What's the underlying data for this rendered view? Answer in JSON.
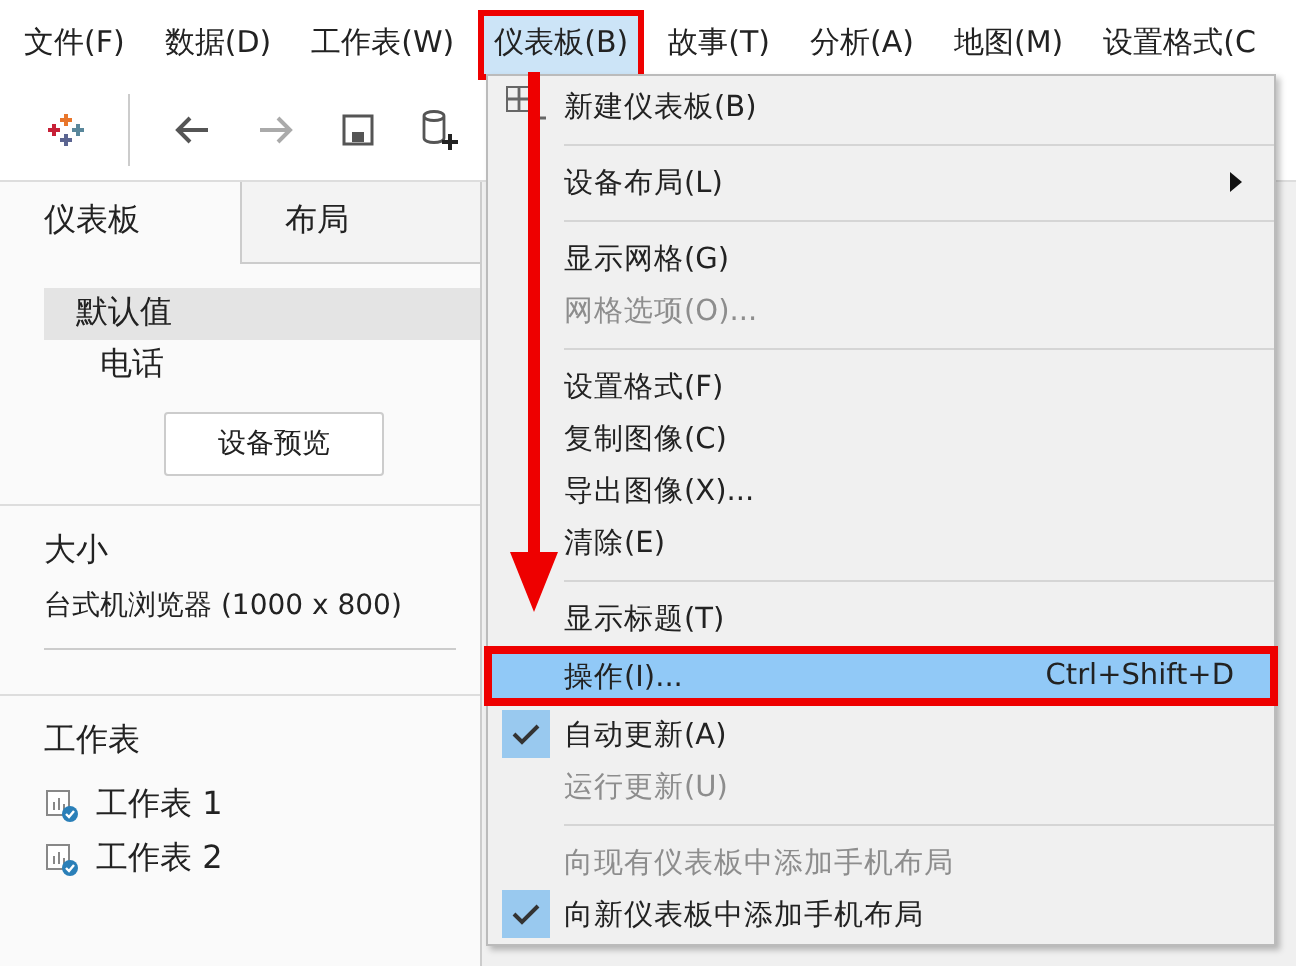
{
  "menubar": [
    {
      "label": "文件(F)",
      "selected": false
    },
    {
      "label": "数据(D)",
      "selected": false
    },
    {
      "label": "工作表(W)",
      "selected": false
    },
    {
      "label": "仪表板(B)",
      "selected": true
    },
    {
      "label": "故事(T)",
      "selected": false
    },
    {
      "label": "分析(A)",
      "selected": false
    },
    {
      "label": "地图(M)",
      "selected": false
    },
    {
      "label": "设置格式(C",
      "selected": false
    }
  ],
  "panel": {
    "tabs": [
      {
        "label": "仪表板",
        "selected": true
      },
      {
        "label": "布局",
        "selected": false
      }
    ],
    "devices": [
      {
        "label": "默认值",
        "selected": true
      },
      {
        "label": "电话",
        "selected": false
      }
    ],
    "preview_button": "设备预览",
    "size_heading": "大小",
    "size_value": "台式机浏览器 (1000 x 800)",
    "sheets_heading": "工作表",
    "sheets": [
      {
        "label": "工作表 1"
      },
      {
        "label": "工作表 2"
      }
    ]
  },
  "menu": [
    {
      "kind": "item",
      "label": "新建仪表板(B)",
      "icon": true,
      "disabled": false,
      "checked": false,
      "submenu": false,
      "selected": false
    },
    {
      "kind": "separator"
    },
    {
      "kind": "item",
      "label": "设备布局(L)",
      "disabled": false,
      "checked": false,
      "submenu": true,
      "selected": false
    },
    {
      "kind": "separator"
    },
    {
      "kind": "item",
      "label": "显示网格(G)",
      "disabled": false,
      "checked": false,
      "submenu": false,
      "selected": false
    },
    {
      "kind": "item",
      "label": "网格选项(O)...",
      "disabled": true,
      "checked": false,
      "submenu": false,
      "selected": false
    },
    {
      "kind": "separator"
    },
    {
      "kind": "item",
      "label": "设置格式(F)",
      "disabled": false,
      "checked": false,
      "submenu": false,
      "selected": false
    },
    {
      "kind": "item",
      "label": "复制图像(C)",
      "disabled": false,
      "checked": false,
      "submenu": false,
      "selected": false
    },
    {
      "kind": "item",
      "label": "导出图像(X)...",
      "disabled": false,
      "checked": false,
      "submenu": false,
      "selected": false
    },
    {
      "kind": "item",
      "label": "清除(E)",
      "disabled": false,
      "checked": false,
      "submenu": false,
      "selected": false
    },
    {
      "kind": "separator"
    },
    {
      "kind": "item",
      "label": "显示标题(T)",
      "disabled": false,
      "checked": false,
      "submenu": false,
      "selected": false
    },
    {
      "kind": "item",
      "label": "操作(I)...",
      "shortcut": "Ctrl+Shift+D",
      "disabled": false,
      "checked": false,
      "submenu": false,
      "selected": true
    },
    {
      "kind": "item",
      "label": "自动更新(A)",
      "disabled": false,
      "checked": true,
      "submenu": false,
      "selected": false
    },
    {
      "kind": "item",
      "label": "运行更新(U)",
      "disabled": true,
      "checked": false,
      "submenu": false,
      "selected": false
    },
    {
      "kind": "separator"
    },
    {
      "kind": "item",
      "label": "向现有仪表板中添加手机布局",
      "disabled": true,
      "checked": false,
      "submenu": false,
      "selected": false
    },
    {
      "kind": "item",
      "label": "向新仪表板中添加手机布局",
      "disabled": false,
      "checked": true,
      "submenu": false,
      "selected": false
    }
  ]
}
